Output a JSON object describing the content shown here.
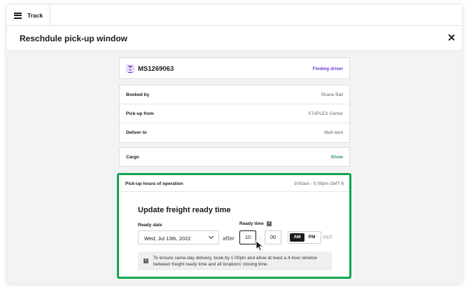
{
  "topbar": {
    "menu_label": "Track"
  },
  "modal": {
    "title": "Reschdule pick-up window"
  },
  "shipment": {
    "id": "MS1269063",
    "status": "Finding driver"
  },
  "details": [
    {
      "label": "Booked by",
      "value": "Shane Ball"
    },
    {
      "label": "Pick-up from",
      "value": "STAPLES Center"
    },
    {
      "label": "Deliver to",
      "value": "Mutt land"
    }
  ],
  "cargo": {
    "label": "Cargo",
    "action": "Show"
  },
  "hours": {
    "label": "Pick-up hours of operation",
    "value": "9:00am - 5:00pm GMT-8"
  },
  "update": {
    "title": "Update freight ready time",
    "ready_date_label": "Ready date",
    "ready_date_value": "Wed, Jul 13th, 2022",
    "after_text": "after",
    "ready_time_label": "Ready time",
    "hour": "10",
    "colon": ":",
    "minute": "00",
    "am": "AM",
    "pm": "PM",
    "selected_period": "AM",
    "timezone": "PDT",
    "note": "To ensure same-day delivery, book by 1:00pm and allow at least a 4-hour window between freight ready time and all locations' closing time."
  },
  "colors": {
    "accent_purple": "#6a35d0",
    "highlight_green": "#10a550",
    "link_green": "#2a9a58"
  },
  "icons": {
    "menu": "hamburger-icon",
    "close": "close-icon",
    "shipment": "hourglass-icon",
    "info": "info-icon",
    "dropdown": "chevron-down-icon",
    "cursor": "mouse-pointer-icon"
  }
}
